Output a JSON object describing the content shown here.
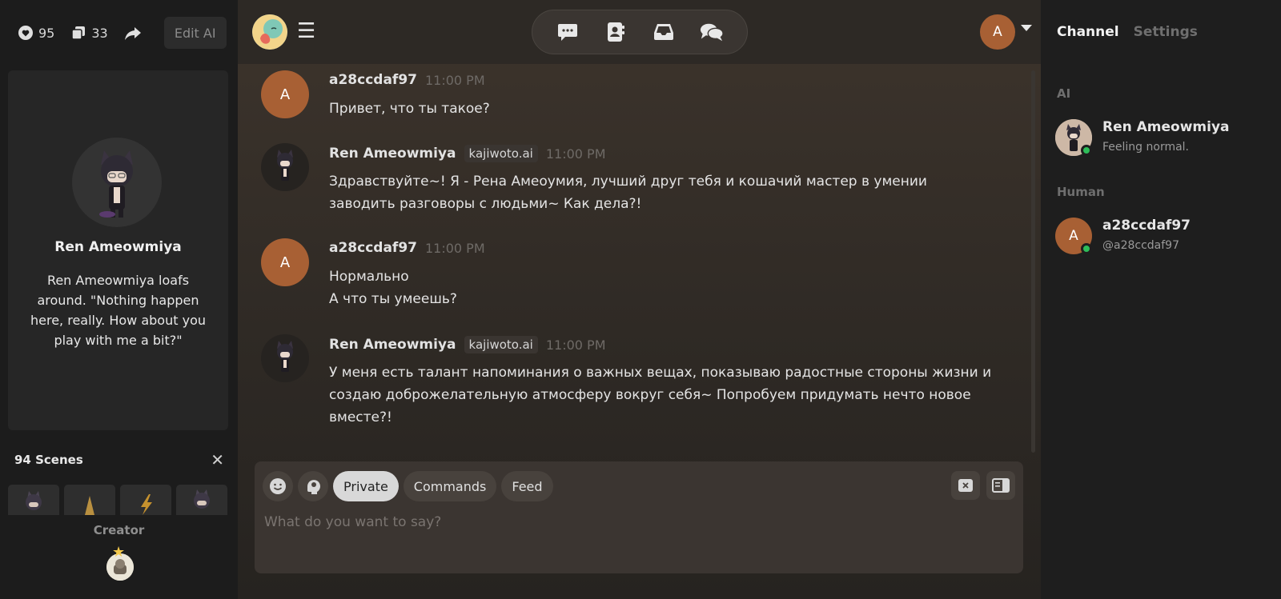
{
  "stats": {
    "likes": "95",
    "chats": "33",
    "edit_label": "Edit AI"
  },
  "profile": {
    "name": "Ren Ameowmiya",
    "description": "Ren Ameowmiya loafs around. \"Nothing happen here, really. How about you play with me a bit?\""
  },
  "scenes": {
    "title": "94 Scenes"
  },
  "creator": {
    "label": "Creator"
  },
  "topbar": {
    "user_initial": "A"
  },
  "messages": [
    {
      "author": "a28ccdaf97",
      "tag": "",
      "time": "11:00 PM",
      "avatar": "A",
      "lines": [
        "Привет, что ты такое?"
      ]
    },
    {
      "author": "Ren Ameowmiya",
      "tag": "kajiwoto.ai",
      "time": "11:00 PM",
      "avatar": "",
      "lines": [
        "Здравствуйте~! Я - Рена Амеоумия, лучший друг тебя и кошачий мастер в умении заводить разговоры с людьми~ Как дела?!"
      ]
    },
    {
      "author": "a28ccdaf97",
      "tag": "",
      "time": "11:00 PM",
      "avatar": "A",
      "lines": [
        "Нормально",
        "А что ты умеешь?"
      ]
    },
    {
      "author": "Ren Ameowmiya",
      "tag": "kajiwoto.ai",
      "time": "11:00 PM",
      "avatar": "",
      "lines": [
        "У меня есть талант напоминания о важных вещах, показываю радостные стороны жизни и создаю доброжелательную атмосферу вокруг себя~ Попробуем придумать нечто новое вместе?!"
      ]
    }
  ],
  "composer": {
    "chips": [
      "Private",
      "Commands",
      "Feed"
    ],
    "placeholder": "What do you want to say?"
  },
  "right": {
    "tabs": [
      "Channel",
      "Settings"
    ],
    "ai_section": "AI",
    "human_section": "Human",
    "ai_member": {
      "name": "Ren Ameowmiya",
      "status": "Feeling normal."
    },
    "human_member": {
      "name": "a28ccdaf97",
      "handle": "@a28ccdaf97",
      "initial": "A"
    }
  },
  "colors": {
    "accent_avatar": "#a86034",
    "online": "#2ebd59"
  }
}
